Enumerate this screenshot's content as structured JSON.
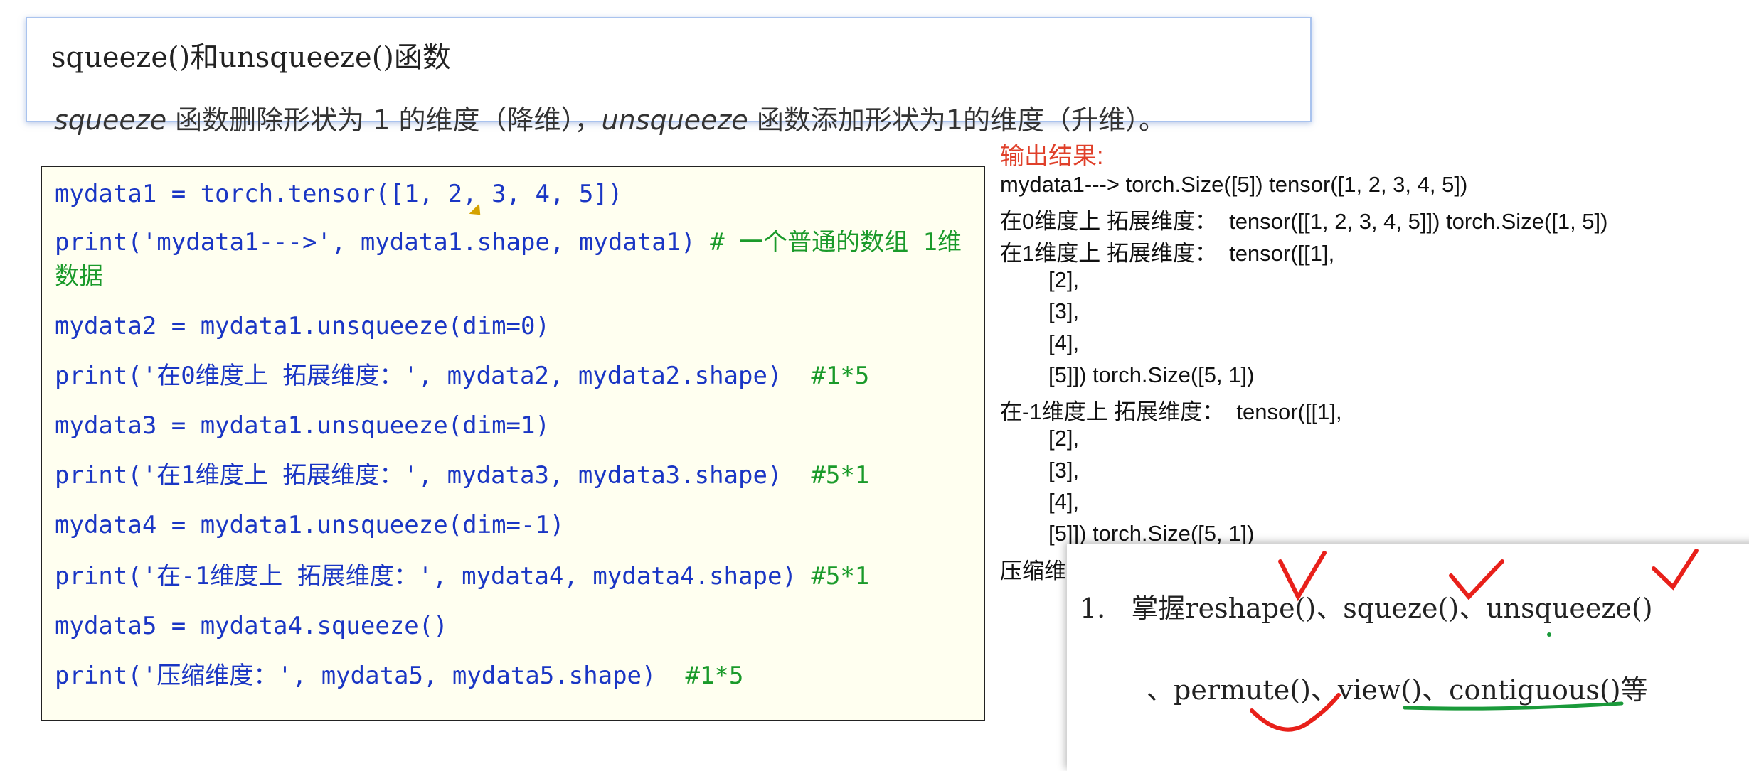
{
  "header": {
    "title": "squeeze()和unsqueeze()函数",
    "desc_part1": "squeeze",
    "desc_part2": " 函数删除形状为 1 的维度（降维），",
    "desc_part3": "unsqueeze",
    "desc_part4": " 函数添加形状为1的维度（升维）。"
  },
  "code": {
    "l1": "mydata1 = torch.tensor([1, 2, 3, 4, 5])",
    "l2_code": "print('mydata1--->', mydata1.shape, mydata1) ",
    "l2_comment": "# 一个普通的数组 1维数据",
    "l3": "mydata2 = mydata1.unsqueeze(dim=0)",
    "l4_code": "print('在0维度上 拓展维度：', mydata2, mydata2.shape)  ",
    "l4_comment": "#1*5",
    "l5": "mydata3 = mydata1.unsqueeze(dim=1)",
    "l6_code": "print('在1维度上 拓展维度：', mydata3, mydata3.shape)  ",
    "l6_comment": "#5*1",
    "l7": "mydata4 = mydata1.unsqueeze(dim=-1)",
    "l8_code": "print('在-1维度上 拓展维度：', mydata4, mydata4.shape) ",
    "l8_comment": "#5*1",
    "l9": "mydata5 = mydata4.squeeze()",
    "l10_code": "print('压缩维度：', mydata5, mydata5.shape)  ",
    "l10_comment": "#1*5"
  },
  "output": {
    "label": "输出结果:",
    "lines": [
      "mydata1---> torch.Size([5]) tensor([1, 2, 3, 4, 5])",
      "在0维度上 拓展维度：  tensor([[1, 2, 3, 4, 5]]) torch.Size([1, 5])",
      "在1维度上 拓展维度：  tensor([[1],",
      "[2],",
      "[3],",
      "[4],",
      "[5]]) torch.Size([5, 1])",
      "在-1维度上 拓展维度：  tensor([[1],",
      "[2],",
      "[3],",
      "[4],",
      "[5]]) torch.Size([5, 1])",
      "压缩维"
    ]
  },
  "overlay": {
    "line1": "1.   掌握reshape()、squeze()、unsqueeze()",
    "line2": "、permute()、view()、contiguous()等"
  },
  "colors": {
    "code_text": "#1a36c4",
    "comment": "#1a9a2a",
    "output_label": "#e0402a",
    "red_marks": "#e8201a",
    "green_mark": "#1a9a3a"
  }
}
